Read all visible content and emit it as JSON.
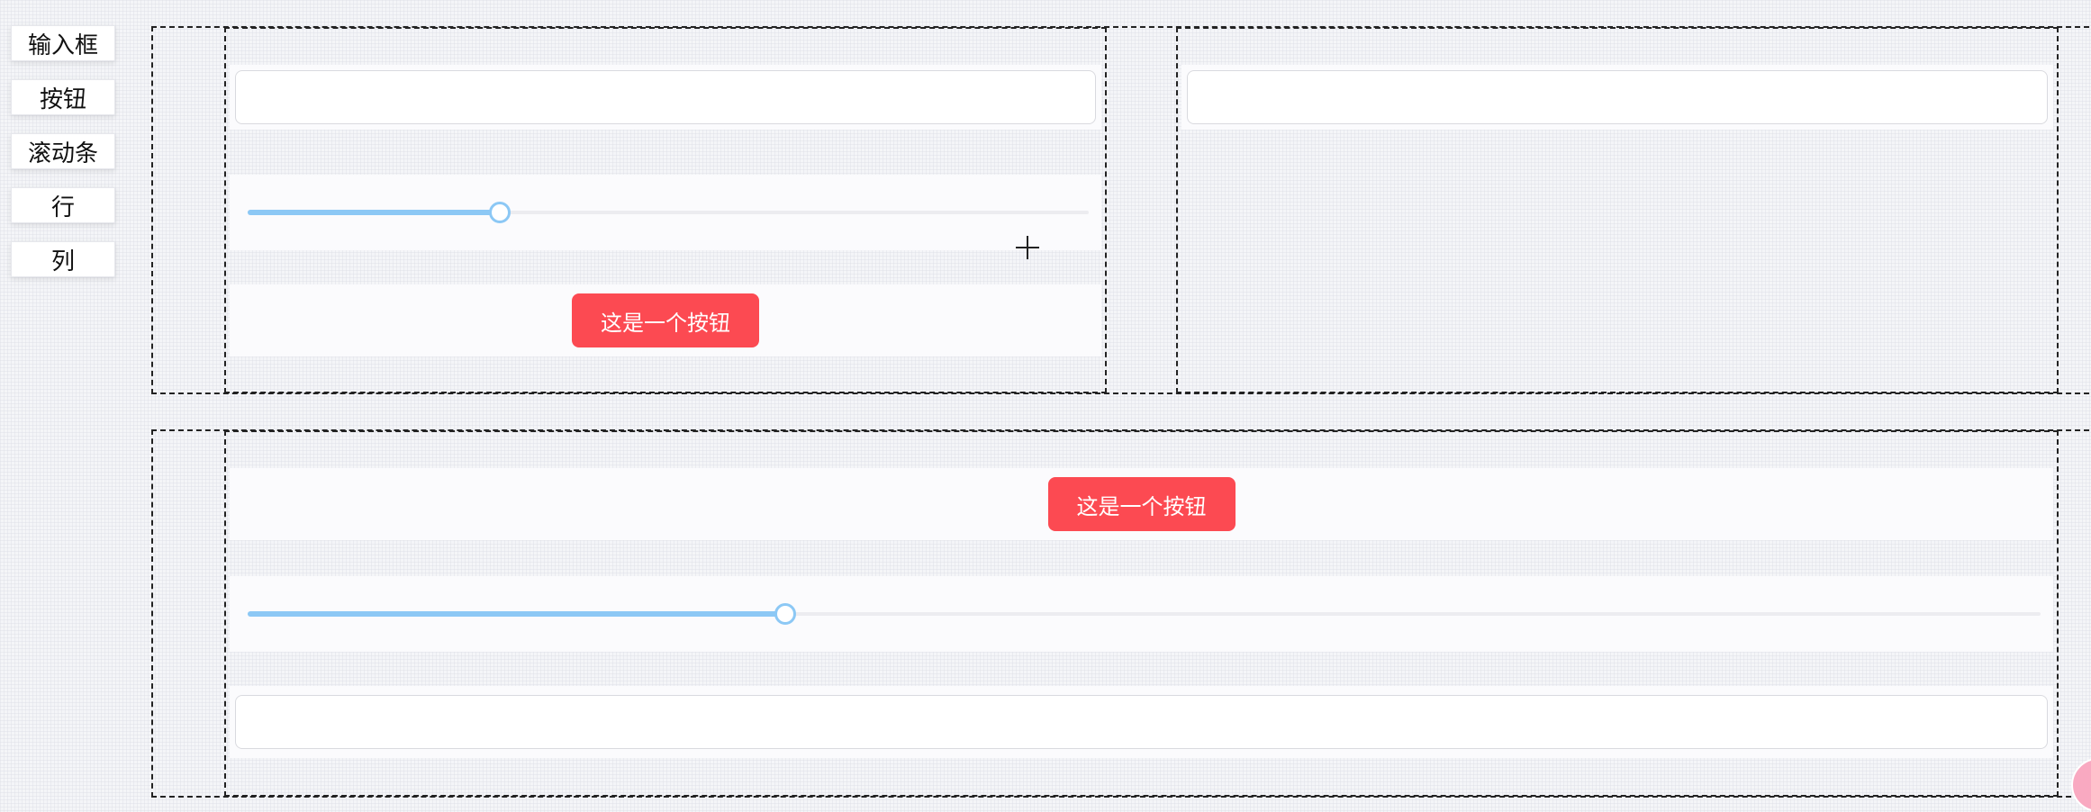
{
  "palette": {
    "items": [
      "输入框",
      "按钮",
      "滚动条",
      "行",
      "列"
    ]
  },
  "colors": {
    "accent_button": "#fc4a52",
    "slider": "#8cc8f5",
    "dashed_border": "#222222",
    "floating_button": "#f9a9c1"
  },
  "canvas": {
    "column_a": {
      "input_value": "",
      "slider_value": 0.3,
      "button_label": "这是一个按钮"
    },
    "column_b": {
      "input_value": ""
    },
    "column_c": {
      "button_label": "这是一个按钮",
      "slider_value": 0.3,
      "input_value": ""
    }
  },
  "icons": {
    "cursor": "crosshair-icon",
    "floating": "floating-action-icon"
  }
}
